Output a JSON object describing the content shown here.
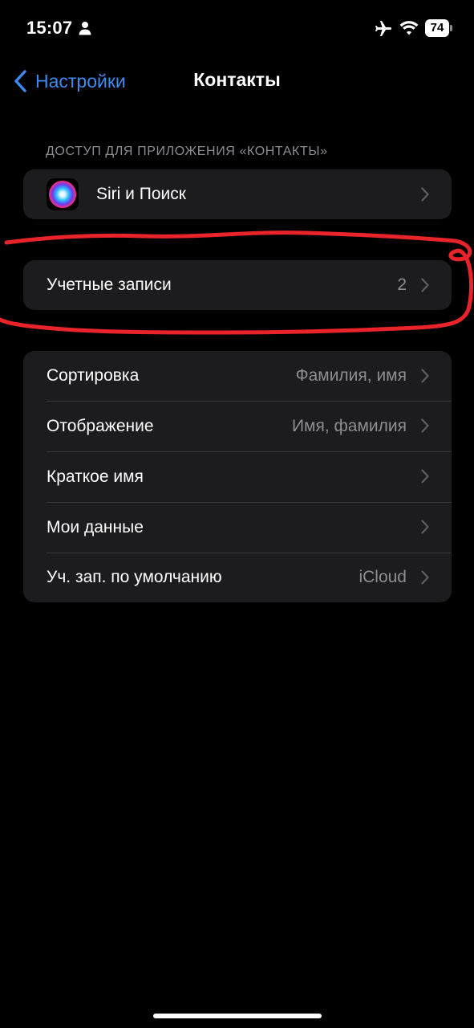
{
  "status_bar": {
    "time": "15:07",
    "battery_level": "74"
  },
  "nav": {
    "back_label": "Настройки",
    "title": "Контакты"
  },
  "access_section": {
    "header": "ДОСТУП ДЛЯ ПРИЛОЖЕНИЯ «КОНТАКТЫ»",
    "items": [
      {
        "label": "Siri и Поиск",
        "icon": "siri-icon"
      }
    ]
  },
  "accounts_section": {
    "items": [
      {
        "label": "Учетные записи",
        "value": "2"
      }
    ]
  },
  "settings_section": {
    "items": [
      {
        "label": "Сортировка",
        "value": "Фамилия, имя"
      },
      {
        "label": "Отображение",
        "value": "Имя, фамилия"
      },
      {
        "label": "Краткое имя",
        "value": ""
      },
      {
        "label": "Мои данные",
        "value": ""
      },
      {
        "label": "Уч. зап. по умолчанию",
        "value": "iCloud"
      }
    ]
  },
  "colors": {
    "background": "#000000",
    "cell": "#1c1c1e",
    "accent": "#3d8bf2",
    "secondary_text": "#8d8d93",
    "annotation": "#e8232a"
  }
}
